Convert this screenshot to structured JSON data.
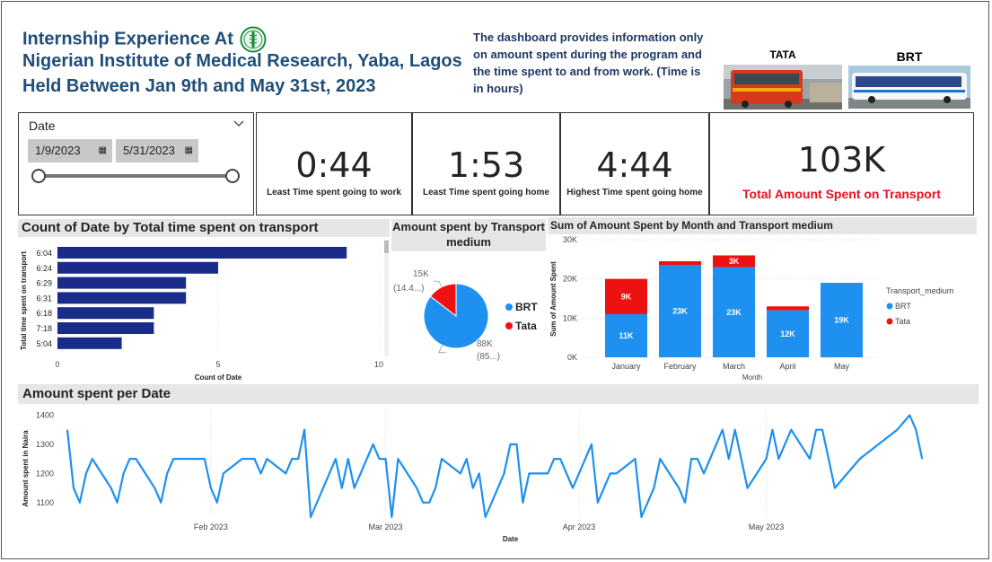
{
  "header": {
    "title_line1": "Internship Experience At",
    "title_line2": "Nigerian Institute of Medical Research, Yaba, Lagos",
    "title_line3": "Held Between Jan 9th and May 31st, 2023",
    "description": "The dashboard provides information only on amount spent during the program and the time spent to and from work. (Time is in hours)",
    "logo_icon": "nimr-logo-icon"
  },
  "images": {
    "tata_label": "TATA",
    "brt_label": "BRT"
  },
  "filter": {
    "label": "Date",
    "start": "1/9/2023",
    "end": "5/31/2023",
    "start_fraction": 0,
    "end_fraction": 1
  },
  "kpis": [
    {
      "value": "0:44",
      "label": "Least Time spent going to work"
    },
    {
      "value": "1:53",
      "label": "Least Time spent going home"
    },
    {
      "value": "4:44",
      "label": "Highest Time spent going home"
    }
  ],
  "total": {
    "value": "103K",
    "label": "Total Amount Spent on Transport"
  },
  "colors": {
    "navy": "#1a2c8a",
    "blue": "#1e90f0",
    "red": "#ee1111",
    "title": "#1f4e79"
  },
  "hbar_title": "Count of Date by Total time spent on transport",
  "pie_title": "Amount spent by Transport medium",
  "stacked_title": "Sum of Amount Spent by Month and Transport medium",
  "line_title": "Amount spent per Date",
  "chart_data": [
    {
      "type": "bar",
      "orientation": "horizontal",
      "title": "Count of Date by Total time spent on transport",
      "xlabel": "Count of Date",
      "ylabel": "Total time spent on transport",
      "categories": [
        "6:04",
        "6:24",
        "6:29",
        "6:31",
        "6:18",
        "7:18",
        "5:04"
      ],
      "values": [
        9,
        5,
        4,
        4,
        3,
        3,
        2
      ],
      "xlim": [
        0,
        10
      ],
      "xticks": [
        "0",
        "5",
        "10"
      ]
    },
    {
      "type": "pie",
      "title": "Amount spent by Transport medium",
      "slices": [
        {
          "name": "BRT",
          "value": 88,
          "label1": "88K",
          "label2": "(85...)"
        },
        {
          "name": "Tata",
          "value": 15,
          "label1": "15K",
          "label2": "(14.4...)"
        }
      ],
      "legend": [
        "BRT",
        "Tata"
      ]
    },
    {
      "type": "bar",
      "stacked": true,
      "title": "Sum of Amount Spent by Month and Transport medium",
      "xlabel": "Month",
      "ylabel": "Sum of Amount Spent",
      "categories": [
        "January",
        "February",
        "March",
        "April",
        "May"
      ],
      "series": [
        {
          "name": "BRT",
          "values": [
            11,
            23.5,
            23,
            12,
            19
          ],
          "labels": [
            "11K",
            "23K",
            "23K",
            "12K",
            "19K"
          ]
        },
        {
          "name": "Tata",
          "values": [
            9,
            1,
            3,
            1,
            0
          ],
          "labels": [
            "9K",
            "",
            "3K",
            "",
            ""
          ]
        }
      ],
      "ylim": [
        0,
        30
      ],
      "yticks": [
        "0K",
        "10K",
        "20K",
        "30K"
      ],
      "legend_title": "Transport_medium"
    },
    {
      "type": "line",
      "title": "Amount spent per Date",
      "xlabel": "Date",
      "ylabel": "Amount spent in Naira",
      "ylim": [
        1050,
        1420
      ],
      "yticks": [
        1100,
        1200,
        1300,
        1400
      ],
      "x_range": [
        "2023-01-09",
        "2023-05-31"
      ],
      "x_ticks": [
        {
          "date": "2023-02-01",
          "label": "Feb 2023"
        },
        {
          "date": "2023-03-01",
          "label": "Mar 2023"
        },
        {
          "date": "2023-04-01",
          "label": "Apr 2023"
        },
        {
          "date": "2023-05-01",
          "label": "May 2023"
        }
      ],
      "points": [
        [
          "2023-01-09",
          1350
        ],
        [
          "2023-01-10",
          1150
        ],
        [
          "2023-01-11",
          1100
        ],
        [
          "2023-01-12",
          1200
        ],
        [
          "2023-01-13",
          1250
        ],
        [
          "2023-01-16",
          1150
        ],
        [
          "2023-01-17",
          1100
        ],
        [
          "2023-01-18",
          1200
        ],
        [
          "2023-01-19",
          1250
        ],
        [
          "2023-01-20",
          1250
        ],
        [
          "2023-01-23",
          1150
        ],
        [
          "2023-01-24",
          1100
        ],
        [
          "2023-01-25",
          1200
        ],
        [
          "2023-01-26",
          1250
        ],
        [
          "2023-01-27",
          1250
        ],
        [
          "2023-01-30",
          1250
        ],
        [
          "2023-01-31",
          1250
        ],
        [
          "2023-02-01",
          1150
        ],
        [
          "2023-02-02",
          1100
        ],
        [
          "2023-02-03",
          1200
        ],
        [
          "2023-02-06",
          1250
        ],
        [
          "2023-02-07",
          1250
        ],
        [
          "2023-02-08",
          1250
        ],
        [
          "2023-02-09",
          1200
        ],
        [
          "2023-02-10",
          1250
        ],
        [
          "2023-02-13",
          1200
        ],
        [
          "2023-02-14",
          1250
        ],
        [
          "2023-02-15",
          1250
        ],
        [
          "2023-02-16",
          1350
        ],
        [
          "2023-02-17",
          1050
        ],
        [
          "2023-02-20",
          1200
        ],
        [
          "2023-02-21",
          1250
        ],
        [
          "2023-02-22",
          1150
        ],
        [
          "2023-02-23",
          1250
        ],
        [
          "2023-02-24",
          1150
        ],
        [
          "2023-02-27",
          1300
        ],
        [
          "2023-02-28",
          1250
        ],
        [
          "2023-03-01",
          1250
        ],
        [
          "2023-03-02",
          1050
        ],
        [
          "2023-03-03",
          1250
        ],
        [
          "2023-03-06",
          1150
        ],
        [
          "2023-03-07",
          1100
        ],
        [
          "2023-03-08",
          1100
        ],
        [
          "2023-03-09",
          1150
        ],
        [
          "2023-03-10",
          1250
        ],
        [
          "2023-03-13",
          1200
        ],
        [
          "2023-03-14",
          1250
        ],
        [
          "2023-03-15",
          1150
        ],
        [
          "2023-03-16",
          1200
        ],
        [
          "2023-03-17",
          1050
        ],
        [
          "2023-03-20",
          1200
        ],
        [
          "2023-03-21",
          1300
        ],
        [
          "2023-03-22",
          1300
        ],
        [
          "2023-03-23",
          1100
        ],
        [
          "2023-03-24",
          1200
        ],
        [
          "2023-03-27",
          1200
        ],
        [
          "2023-03-28",
          1250
        ],
        [
          "2023-03-29",
          1250
        ],
        [
          "2023-03-30",
          1200
        ],
        [
          "2023-03-31",
          1150
        ],
        [
          "2023-04-03",
          1300
        ],
        [
          "2023-04-04",
          1100
        ],
        [
          "2023-04-05",
          1150
        ],
        [
          "2023-04-06",
          1200
        ],
        [
          "2023-04-07",
          1200
        ],
        [
          "2023-04-10",
          1250
        ],
        [
          "2023-04-11",
          1050
        ],
        [
          "2023-04-12",
          1100
        ],
        [
          "2023-04-13",
          1150
        ],
        [
          "2023-04-14",
          1250
        ],
        [
          "2023-04-17",
          1150
        ],
        [
          "2023-04-18",
          1100
        ],
        [
          "2023-04-19",
          1250
        ],
        [
          "2023-04-20",
          1250
        ],
        [
          "2023-04-21",
          1200
        ],
        [
          "2023-04-24",
          1350
        ],
        [
          "2023-04-25",
          1250
        ],
        [
          "2023-04-26",
          1350
        ],
        [
          "2023-04-27",
          1250
        ],
        [
          "2023-04-28",
          1150
        ],
        [
          "2023-05-01",
          1250
        ],
        [
          "2023-05-02",
          1350
        ],
        [
          "2023-05-03",
          1250
        ],
        [
          "2023-05-04",
          1300
        ],
        [
          "2023-05-05",
          1350
        ],
        [
          "2023-05-08",
          1250
        ],
        [
          "2023-05-09",
          1350
        ],
        [
          "2023-05-10",
          1350
        ],
        [
          "2023-05-11",
          1250
        ],
        [
          "2023-05-12",
          1150
        ],
        [
          "2023-05-16",
          1250
        ],
        [
          "2023-05-19",
          1300
        ],
        [
          "2023-05-22",
          1350
        ],
        [
          "2023-05-24",
          1400
        ],
        [
          "2023-05-25",
          1350
        ],
        [
          "2023-05-26",
          1250
        ]
      ]
    }
  ]
}
